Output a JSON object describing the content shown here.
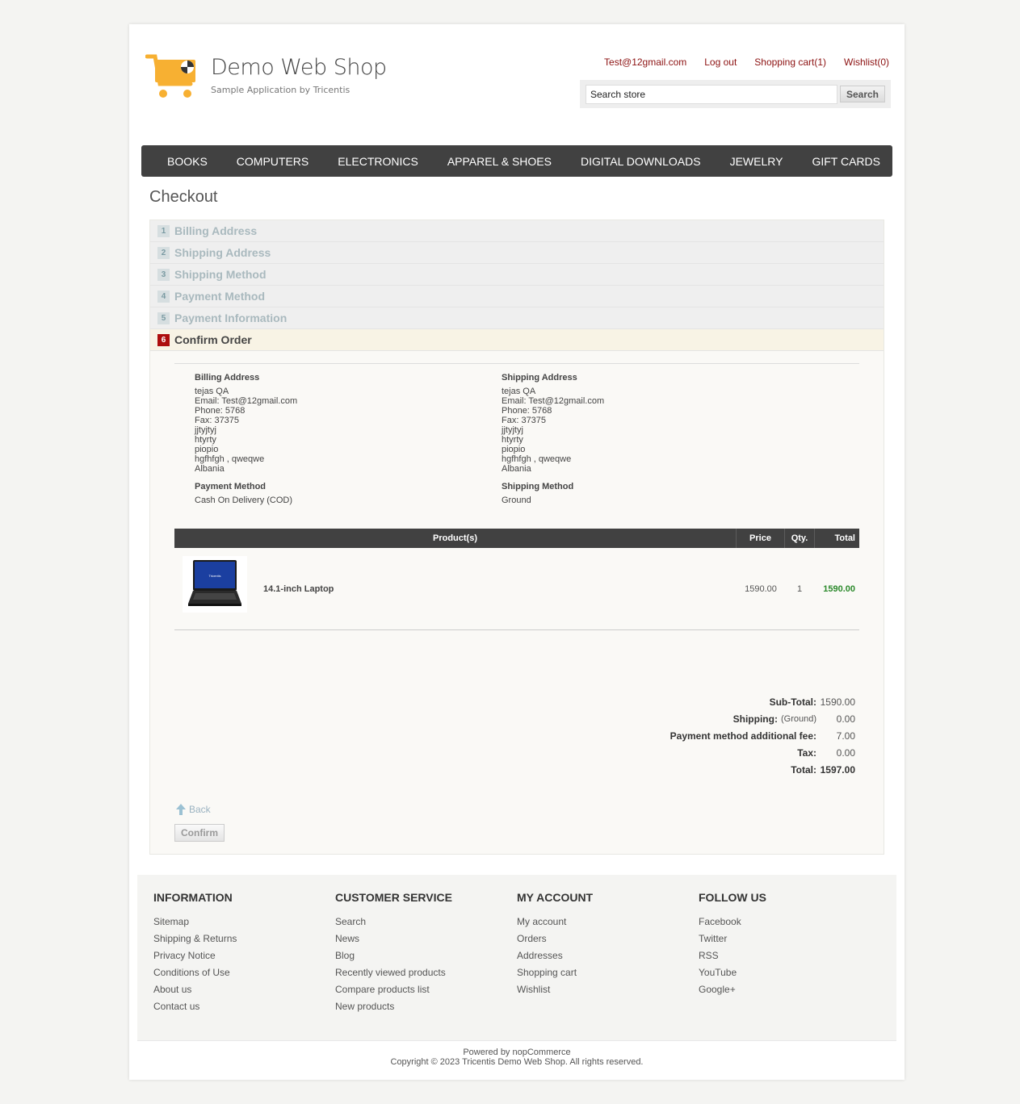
{
  "header": {
    "title": "Demo Web Shop",
    "subtitle": "Sample Application by Tricentis",
    "links": {
      "account": "Test@12gmail.com",
      "logout": "Log out",
      "cart": "Shopping cart(1)",
      "wishlist": "Wishlist(0)"
    },
    "search": {
      "value": "Search store",
      "button": "Search"
    }
  },
  "nav": [
    "BOOKS",
    "COMPUTERS",
    "ELECTRONICS",
    "APPAREL & SHOES",
    "DIGITAL DOWNLOADS",
    "JEWELRY",
    "GIFT CARDS"
  ],
  "page_title": "Checkout",
  "steps": [
    {
      "num": "1",
      "label": "Billing Address"
    },
    {
      "num": "2",
      "label": "Shipping Address"
    },
    {
      "num": "3",
      "label": "Shipping Method"
    },
    {
      "num": "4",
      "label": "Payment Method"
    },
    {
      "num": "5",
      "label": "Payment Information"
    },
    {
      "num": "6",
      "label": "Confirm Order"
    }
  ],
  "billing": {
    "heading": "Billing Address",
    "name": "tejas QA",
    "email": "Email: Test@12gmail.com",
    "phone": "Phone: 5768",
    "fax": "Fax: 37375",
    "line1": "jjtyjtyj",
    "line2": "htyrty",
    "line3": "piopio",
    "city": "hgfhfgh , qweqwe",
    "country": "Albania"
  },
  "shipping": {
    "heading": "Shipping Address",
    "name": "tejas QA",
    "email": "Email: Test@12gmail.com",
    "phone": "Phone: 5768",
    "fax": "Fax: 37375",
    "line1": "jjtyjtyj",
    "line2": "htyrty",
    "line3": "piopio",
    "city": "hgfhfgh , qweqwe",
    "country": "Albania"
  },
  "payment_method": {
    "heading": "Payment Method",
    "value": "Cash On Delivery (COD)"
  },
  "shipping_method": {
    "heading": "Shipping Method",
    "value": "Ground"
  },
  "grid": {
    "headers": {
      "product": "Product(s)",
      "price": "Price",
      "qty": "Qty.",
      "total": "Total"
    },
    "item": {
      "name": "14.1-inch Laptop",
      "price": "1590.00",
      "qty": "1",
      "total": "1590.00",
      "brand": "Tricentis"
    }
  },
  "totals": {
    "subtotal_label": "Sub-Total:",
    "subtotal": "1590.00",
    "shipping_label": "Shipping:",
    "shipping_method": "(Ground)",
    "shipping": "0.00",
    "fee_label": "Payment method additional fee:",
    "fee": "7.00",
    "tax_label": "Tax:",
    "tax": "0.00",
    "total_label": "Total:",
    "total": "1597.00"
  },
  "actions": {
    "back": "Back",
    "confirm": "Confirm"
  },
  "footer": {
    "information": {
      "title": "INFORMATION",
      "links": [
        "Sitemap",
        "Shipping & Returns",
        "Privacy Notice",
        "Conditions of Use",
        "About us",
        "Contact us"
      ]
    },
    "customer_service": {
      "title": "CUSTOMER SERVICE",
      "links": [
        "Search",
        "News",
        "Blog",
        "Recently viewed products",
        "Compare products list",
        "New products"
      ]
    },
    "my_account": {
      "title": "MY ACCOUNT",
      "links": [
        "My account",
        "Orders",
        "Addresses",
        "Shopping cart",
        "Wishlist"
      ]
    },
    "follow_us": {
      "title": "FOLLOW US",
      "links": [
        "Facebook",
        "Twitter",
        "RSS",
        "YouTube",
        "Google+"
      ]
    },
    "powered": "Powered by nopCommerce",
    "copyright": "Copyright © 2023 Tricentis Demo Web Shop. All rights reserved."
  },
  "colors": {
    "accent": "#8c1111",
    "nav_bg": "#414141",
    "active_step": "#ad0d0d",
    "total_green": "#2c8a2c"
  }
}
